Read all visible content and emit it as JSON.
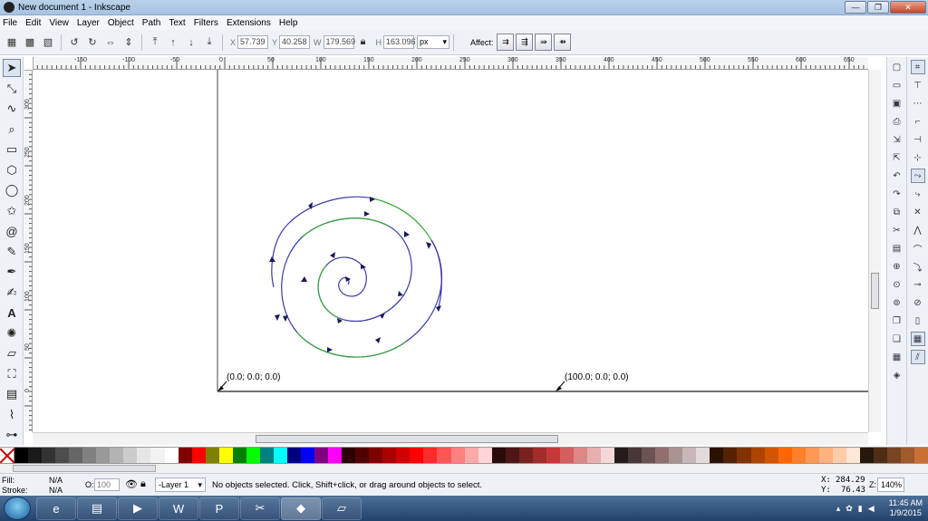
{
  "window": {
    "title": "New document 1 - Inkscape",
    "buttons": {
      "minimize": "—",
      "maximize": "❐",
      "close": "✕"
    }
  },
  "menu": [
    "File",
    "Edit",
    "View",
    "Layer",
    "Object",
    "Path",
    "Text",
    "Filters",
    "Extensions",
    "Help"
  ],
  "controls": {
    "x_label": "X",
    "x_value": "57.739",
    "y_label": "Y",
    "y_value": "40.258",
    "w_label": "W",
    "w_value": "179.569",
    "h_label": "H",
    "h_value": "163.096",
    "unit": "px",
    "affect_label": "Affect:"
  },
  "ruler": {
    "h_labels": [
      "-150",
      "-100",
      "-50",
      "0",
      "50",
      "100",
      "150",
      "200",
      "250",
      "300",
      "350",
      "400",
      "450",
      "500",
      "550",
      "600",
      "650"
    ],
    "v_labels": [
      "0",
      "50",
      "100",
      "150",
      "200",
      "250",
      "300",
      "350",
      "400",
      "450"
    ]
  },
  "canvas": {
    "label_origin": "(0.0; 0.0; 0.0)",
    "label_end": "(100.0; 0.0; 0.0)",
    "spiral_colors": {
      "blue": "#3a3aa6",
      "green": "#3aa63a"
    }
  },
  "palette": [
    "#000000",
    "#1a1a1a",
    "#333333",
    "#4d4d4d",
    "#666666",
    "#808080",
    "#999999",
    "#b3b3b3",
    "#cccccc",
    "#e6e6e6",
    "#f2f2f2",
    "#ffffff",
    "#800000",
    "#ff0000",
    "#808000",
    "#ffff00",
    "#008000",
    "#00ff00",
    "#008080",
    "#00ffff",
    "#000080",
    "#0000ff",
    "#800080",
    "#ff00ff",
    "#2b0000",
    "#550000",
    "#800000",
    "#aa0000",
    "#d40000",
    "#ff0000",
    "#ff2a2a",
    "#ff5555",
    "#ff8080",
    "#ffaaaa",
    "#ffd5d5",
    "#280b0b",
    "#501616",
    "#782121",
    "#a02c2c",
    "#c83737",
    "#d35f5f",
    "#de8787",
    "#e9afaf",
    "#f4d7d7",
    "#241c1c",
    "#483737",
    "#6c5353",
    "#916f6f",
    "#ac9393",
    "#c8b7b7",
    "#e3dbdb",
    "#2b1100",
    "#552200",
    "#803300",
    "#aa4400",
    "#d45500",
    "#ff6600",
    "#ff7f2a",
    "#ff9955",
    "#ffb380",
    "#ffccaa",
    "#ffe6d5",
    "#28170b",
    "#502d16",
    "#784421",
    "#a05a2c",
    "#c87137"
  ],
  "status": {
    "fill_label": "Fill:",
    "fill_value": "N/A",
    "stroke_label": "Stroke:",
    "stroke_value": "N/A",
    "opacity_label": "O:",
    "opacity_value": "100",
    "layer": "-Layer 1",
    "message": "No objects selected. Click, Shift+click, or drag around objects to select.",
    "x_label": "X:",
    "x_value": "284.29",
    "y_label": "Y:",
    "y_value": "76.43",
    "zoom_label": "Z:",
    "zoom_value": "140%"
  },
  "taskbar": {
    "apps": [
      {
        "name": "internet-explorer",
        "glyph": "e"
      },
      {
        "name": "file-explorer",
        "glyph": "▤"
      },
      {
        "name": "media-player",
        "glyph": "▶"
      },
      {
        "name": "word",
        "glyph": "W"
      },
      {
        "name": "powerpoint",
        "glyph": "P"
      },
      {
        "name": "snipping",
        "glyph": "✂"
      },
      {
        "name": "inkscape",
        "glyph": "◆"
      },
      {
        "name": "notes",
        "glyph": "▱"
      }
    ],
    "time": "11:45 AM",
    "date": "1/9/2015"
  }
}
